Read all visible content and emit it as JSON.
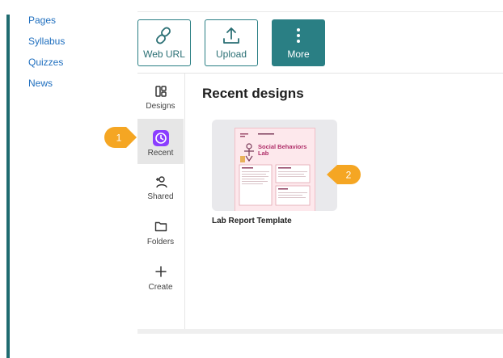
{
  "course_nav": [
    "Pages",
    "Syllabus",
    "Quizzes",
    "News"
  ],
  "toolbar": {
    "web_url_label": "Web URL",
    "upload_label": "Upload",
    "more_label": "More"
  },
  "sidebar": {
    "items": [
      {
        "label": "Designs",
        "icon": "designs-icon"
      },
      {
        "label": "Recent",
        "icon": "clock-icon"
      },
      {
        "label": "Shared",
        "icon": "shared-icon"
      },
      {
        "label": "Folders",
        "icon": "folder-icon"
      },
      {
        "label": "Create",
        "icon": "plus-icon"
      }
    ]
  },
  "main": {
    "title": "Recent designs",
    "designs": [
      {
        "name": "Lab Report Template",
        "thumbnail_title": "Social Behaviors Lab"
      }
    ]
  },
  "callouts": [
    "1",
    "2"
  ],
  "colors": {
    "accent": "#2a7f84",
    "recent_icon": "#8b3dff",
    "callout": "#f5a623",
    "link": "#1f6fbf"
  }
}
